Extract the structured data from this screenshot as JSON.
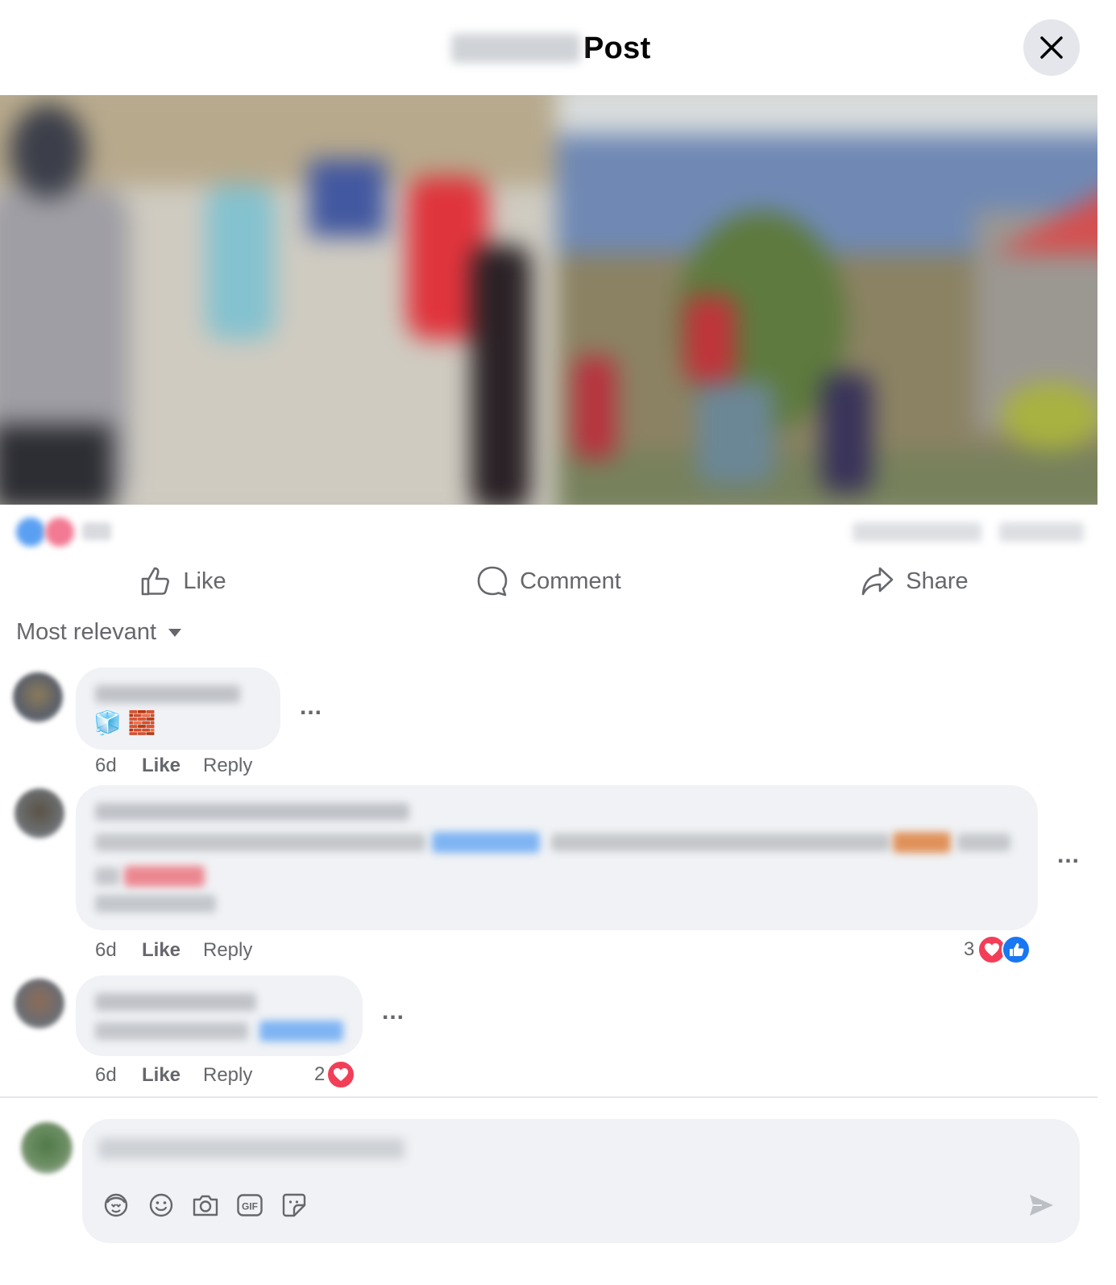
{
  "header": {
    "title": "Post",
    "close_icon": "close-icon"
  },
  "post": {
    "image_alt": "blurred outdoor photo"
  },
  "actions": {
    "like": "Like",
    "comment": "Comment",
    "share": "Share"
  },
  "sort": {
    "label": "Most relevant"
  },
  "comments": [
    {
      "time": "6d",
      "like": "Like",
      "reply": "Reply",
      "emoji": "🧊 🧱",
      "more": "..."
    },
    {
      "time": "6d",
      "like": "Like",
      "reply": "Reply",
      "reactions_count": "3",
      "more": "..."
    },
    {
      "time": "6d",
      "like": "Like",
      "reply": "Reply",
      "reactions_count": "2",
      "more": "..."
    }
  ],
  "composer": {
    "placeholder": "",
    "tools": [
      "avatar-sticker-icon",
      "emoji-icon",
      "camera-icon",
      "gif-icon",
      "sticker-icon"
    ],
    "gif_label": "GIF"
  },
  "colors": {
    "secondary_text": "#65676b",
    "bubble_bg": "#f0f2f5",
    "like_blue": "#1877f2",
    "love_red": "#f33e58"
  }
}
